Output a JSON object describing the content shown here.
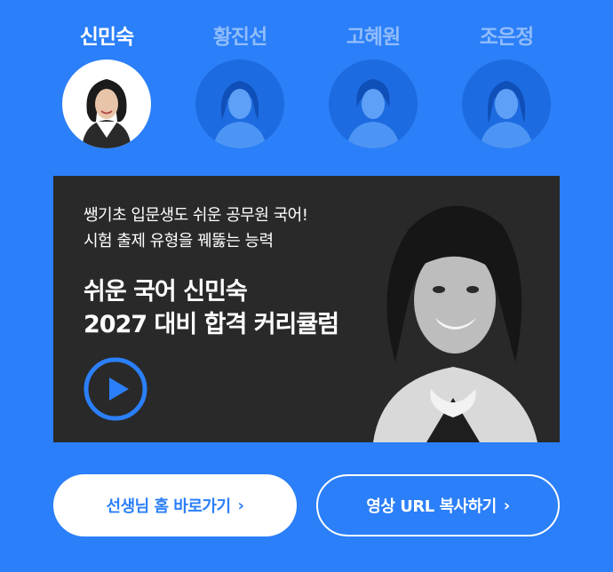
{
  "colors": {
    "background": "#2b7ff8",
    "tab_inactive": "#8fbcfb",
    "tab_active": "#ffffff",
    "banner_bg": "#292929",
    "accent": "#2b7ff8"
  },
  "tabs": [
    {
      "label": "신민숙",
      "active": true,
      "icon": "teacher-portrait"
    },
    {
      "label": "황진선",
      "active": false,
      "icon": "teacher-portrait"
    },
    {
      "label": "고혜원",
      "active": false,
      "icon": "teacher-portrait"
    },
    {
      "label": "조은정",
      "active": false,
      "icon": "teacher-portrait"
    }
  ],
  "banner": {
    "subtitle_line1": "쌩기초 입문생도 쉬운 공무원 국어!",
    "subtitle_line2": "시험 출제 유형을 꿰뚫는 능력",
    "title_line1": "쉬운 국어 신민숙",
    "title_line2": "2027 대비 합격 커리큘럼",
    "play_icon": "play-icon"
  },
  "buttons": {
    "home_label": "선생님 홈 바로가기",
    "copy_label": "영상 URL 복사하기",
    "chevron": "›"
  }
}
